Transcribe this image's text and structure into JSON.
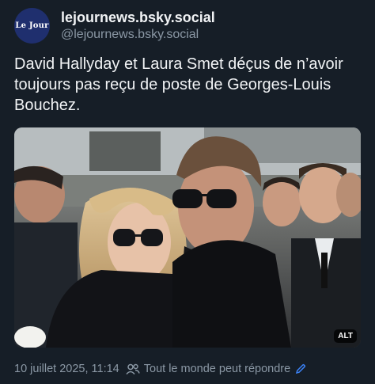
{
  "author": {
    "avatar_text": "Le Jour",
    "display_name": "lejournews.bsky.social",
    "handle": "@lejournews.bsky.social"
  },
  "post": {
    "text": "David Hallyday et Laura Smet déçus de n’avoir toujours pas reçu de poste de Georges-Louis Bouchez.",
    "image": {
      "badge": "ALT",
      "icon": "photo-of-people"
    }
  },
  "footer": {
    "timestamp": "10 juillet 2025, 11:14",
    "reply_setting": "Tout le monde peut répondre",
    "reply_icon": "people-icon",
    "edit_icon": "pencil-icon"
  },
  "colors": {
    "background": "#161e27",
    "text": "#f1f3f5",
    "muted": "#8b98a5",
    "accent": "#3b82f6",
    "avatar_bg": "#1f2f6e"
  }
}
